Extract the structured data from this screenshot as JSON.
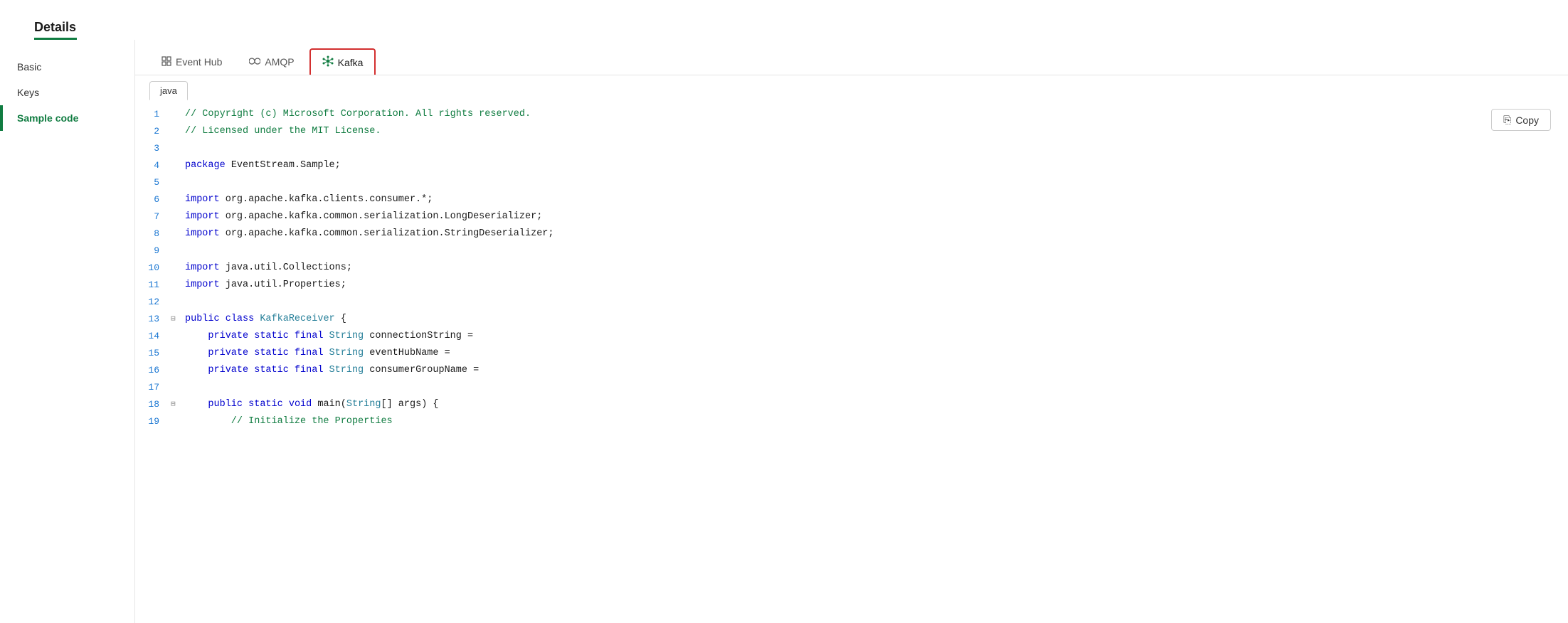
{
  "page": {
    "title": "Details",
    "title_underline_color": "#107c41"
  },
  "sidebar": {
    "items": [
      {
        "id": "basic",
        "label": "Basic",
        "active": false
      },
      {
        "id": "keys",
        "label": "Keys",
        "active": false
      },
      {
        "id": "sample-code",
        "label": "Sample code",
        "active": true
      }
    ]
  },
  "tabs": [
    {
      "id": "event-hub",
      "label": "Event Hub",
      "icon": "⊞",
      "active": false
    },
    {
      "id": "amqp",
      "label": "AMQP",
      "icon": "◇◇",
      "active": false
    },
    {
      "id": "kafka",
      "label": "Kafka",
      "icon": "✦",
      "active": true
    }
  ],
  "lang_tabs": [
    {
      "id": "java",
      "label": "java",
      "active": true
    }
  ],
  "copy_button": {
    "label": "Copy",
    "icon": "copy"
  },
  "code_lines": [
    {
      "num": 1,
      "type": "comment",
      "text": "// Copyright (c) Microsoft Corporation. All rights reserved."
    },
    {
      "num": 2,
      "type": "comment",
      "text": "// Licensed under the MIT License."
    },
    {
      "num": 3,
      "type": "empty",
      "text": ""
    },
    {
      "num": 4,
      "type": "code",
      "text": "package EventStream.Sample;"
    },
    {
      "num": 5,
      "type": "empty",
      "text": ""
    },
    {
      "num": 6,
      "type": "import",
      "text": "import org.apache.kafka.clients.consumer.*;"
    },
    {
      "num": 7,
      "type": "import",
      "text": "import org.apache.kafka.common.serialization.LongDeserializer;"
    },
    {
      "num": 8,
      "type": "import",
      "text": "import org.apache.kafka.common.serialization.StringDeserializer;"
    },
    {
      "num": 9,
      "type": "empty",
      "text": ""
    },
    {
      "num": 10,
      "type": "import",
      "text": "import java.util.Collections;"
    },
    {
      "num": 11,
      "type": "import",
      "text": "import java.util.Properties;"
    },
    {
      "num": 12,
      "type": "empty",
      "text": ""
    },
    {
      "num": 13,
      "type": "class",
      "text": "public class KafkaReceiver {",
      "toggle": true
    },
    {
      "num": 14,
      "type": "field",
      "text": "    private static final String connectionString ="
    },
    {
      "num": 15,
      "type": "field",
      "text": "    private static final String eventHubName ="
    },
    {
      "num": 16,
      "type": "field",
      "text": "    private static final String consumerGroupName ="
    },
    {
      "num": 17,
      "type": "empty",
      "text": ""
    },
    {
      "num": 18,
      "type": "method",
      "text": "    public static void main(String[] args) {",
      "toggle": true
    },
    {
      "num": 19,
      "type": "comment_indent",
      "text": "        // Initialize the Properties"
    }
  ]
}
